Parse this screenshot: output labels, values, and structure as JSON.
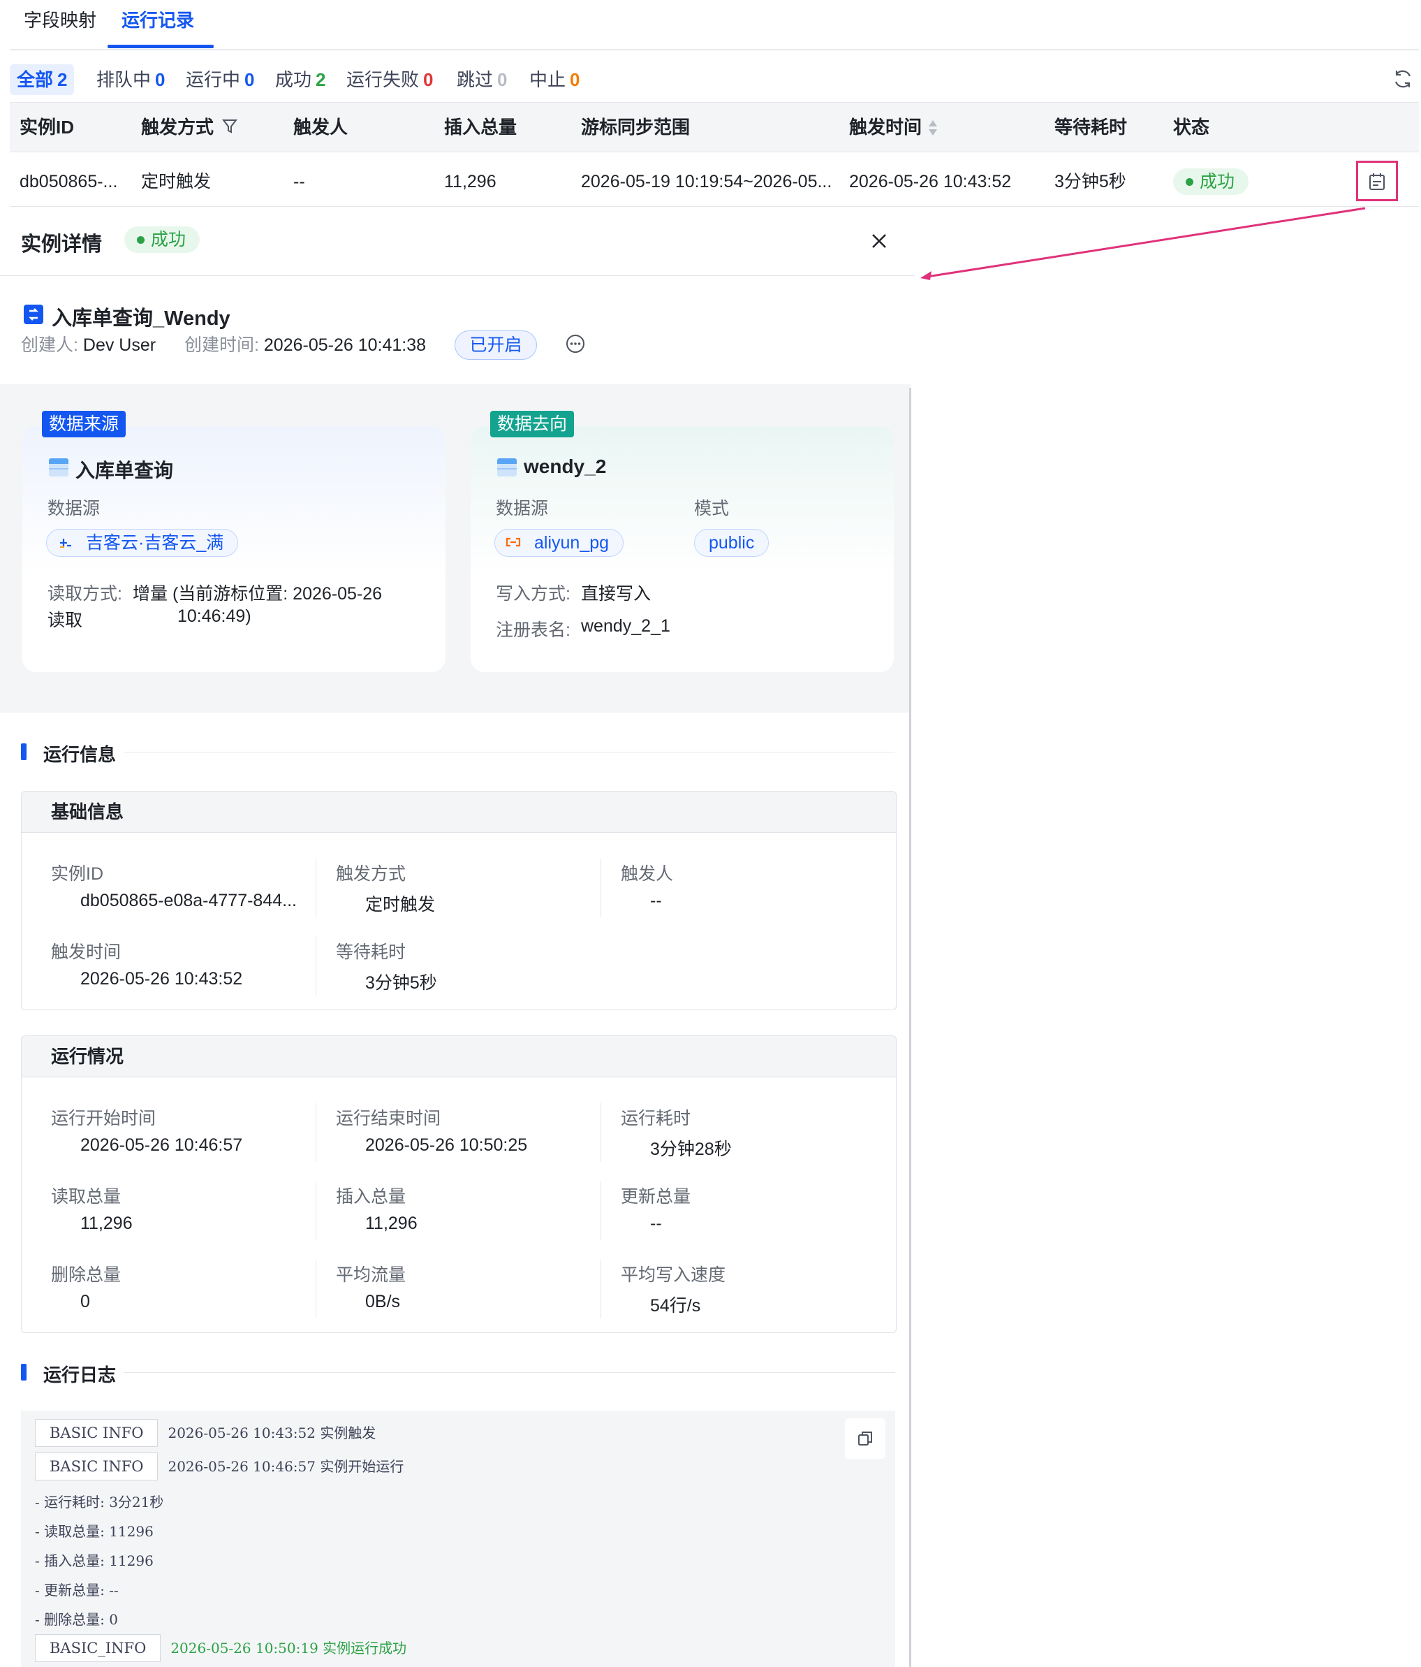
{
  "tabs": [
    {
      "label": "字段映射"
    },
    {
      "label": "运行记录"
    }
  ],
  "filters": [
    {
      "label": "全部",
      "count": "2",
      "color": "#1457f0"
    },
    {
      "label": "排队中",
      "count": "0",
      "color": "#1457f0"
    },
    {
      "label": "运行中",
      "count": "0",
      "color": "#1457f0"
    },
    {
      "label": "成功",
      "count": "2",
      "color": "#2ba245"
    },
    {
      "label": "运行失败",
      "count": "0",
      "color": "#e03636"
    },
    {
      "label": "跳过",
      "count": "0",
      "color": "#b8bcc4"
    },
    {
      "label": "中止",
      "count": "0",
      "color": "#f57c00"
    }
  ],
  "table": {
    "columns": [
      "实例ID",
      "触发方式",
      "触发人",
      "插入总量",
      "游标同步范围",
      "触发时间",
      "等待耗时",
      "状态"
    ],
    "rows": [
      {
        "id": "db050865-...",
        "trigger": "定时触发",
        "triggerer": "--",
        "inserted": "11,296",
        "range": "2026-05-19 10:19:54~2026-05...",
        "time": "2026-05-26 10:43:52",
        "wait": "3分钟5秒",
        "status": "成功"
      }
    ]
  },
  "detail": {
    "title": "实例详情",
    "status": "成功",
    "task_name": "入库单查询_Wendy",
    "creator_label": "创建人:",
    "creator": "Dev User",
    "created_label": "创建时间:",
    "created": "2026-05-26 10:41:38",
    "enabled": "已开启",
    "source": {
      "tag": "数据来源",
      "name": "入库单查询",
      "ds_label": "数据源",
      "ds": "吉客云·吉客云_满",
      "read_label": "读取方式:",
      "read_label2": "读取",
      "read_value": "增量 (当前游标位置: 2026-05-26",
      "read_value2": "10:46:49)"
    },
    "target": {
      "tag": "数据去向",
      "name": "wendy_2",
      "ds_label": "数据源",
      "ds": "aliyun_pg",
      "mode_label": "模式",
      "mode": "public",
      "write_label": "写入方式:",
      "write_value": "直接写入",
      "table_label": "注册表名:",
      "table_value": "wendy_2_1"
    },
    "run_info_title": "运行信息",
    "basic": {
      "title": "基础信息",
      "fields": [
        {
          "k": "实例ID",
          "v": "db050865-e08a-4777-844..."
        },
        {
          "k": "触发方式",
          "v": "定时触发"
        },
        {
          "k": "触发人",
          "v": "--"
        },
        {
          "k": "触发时间",
          "v": "2026-05-26 10:43:52"
        },
        {
          "k": "等待耗时",
          "v": "3分钟5秒"
        }
      ]
    },
    "run": {
      "title": "运行情况",
      "fields": [
        {
          "k": "运行开始时间",
          "v": "2026-05-26 10:46:57"
        },
        {
          "k": "运行结束时间",
          "v": "2026-05-26 10:50:25"
        },
        {
          "k": "运行耗时",
          "v": "3分钟28秒"
        },
        {
          "k": "读取总量",
          "v": "11,296"
        },
        {
          "k": "插入总量",
          "v": "11,296"
        },
        {
          "k": "更新总量",
          "v": "--"
        },
        {
          "k": "删除总量",
          "v": "0"
        },
        {
          "k": "平均流量",
          "v": "0B/s"
        },
        {
          "k": "平均写入速度",
          "v": "54行/s"
        }
      ]
    },
    "log_title": "运行日志",
    "log": [
      {
        "level": "BASIC INFO",
        "text": "2026-05-26 10:43:52 实例触发"
      },
      {
        "level": "BASIC INFO",
        "text": "2026-05-26 10:46:57 实例开始运行"
      },
      {
        "text": "- 运行耗时: 3分21秒"
      },
      {
        "text": "- 读取总量: 11296"
      },
      {
        "text": "- 插入总量: 11296"
      },
      {
        "text": "- 更新总量: --"
      },
      {
        "text": "- 删除总量: 0"
      },
      {
        "level": "BASIC_INFO",
        "text": "2026-05-26 10:50:19 实例运行成功",
        "color": "#2ba245"
      }
    ]
  }
}
